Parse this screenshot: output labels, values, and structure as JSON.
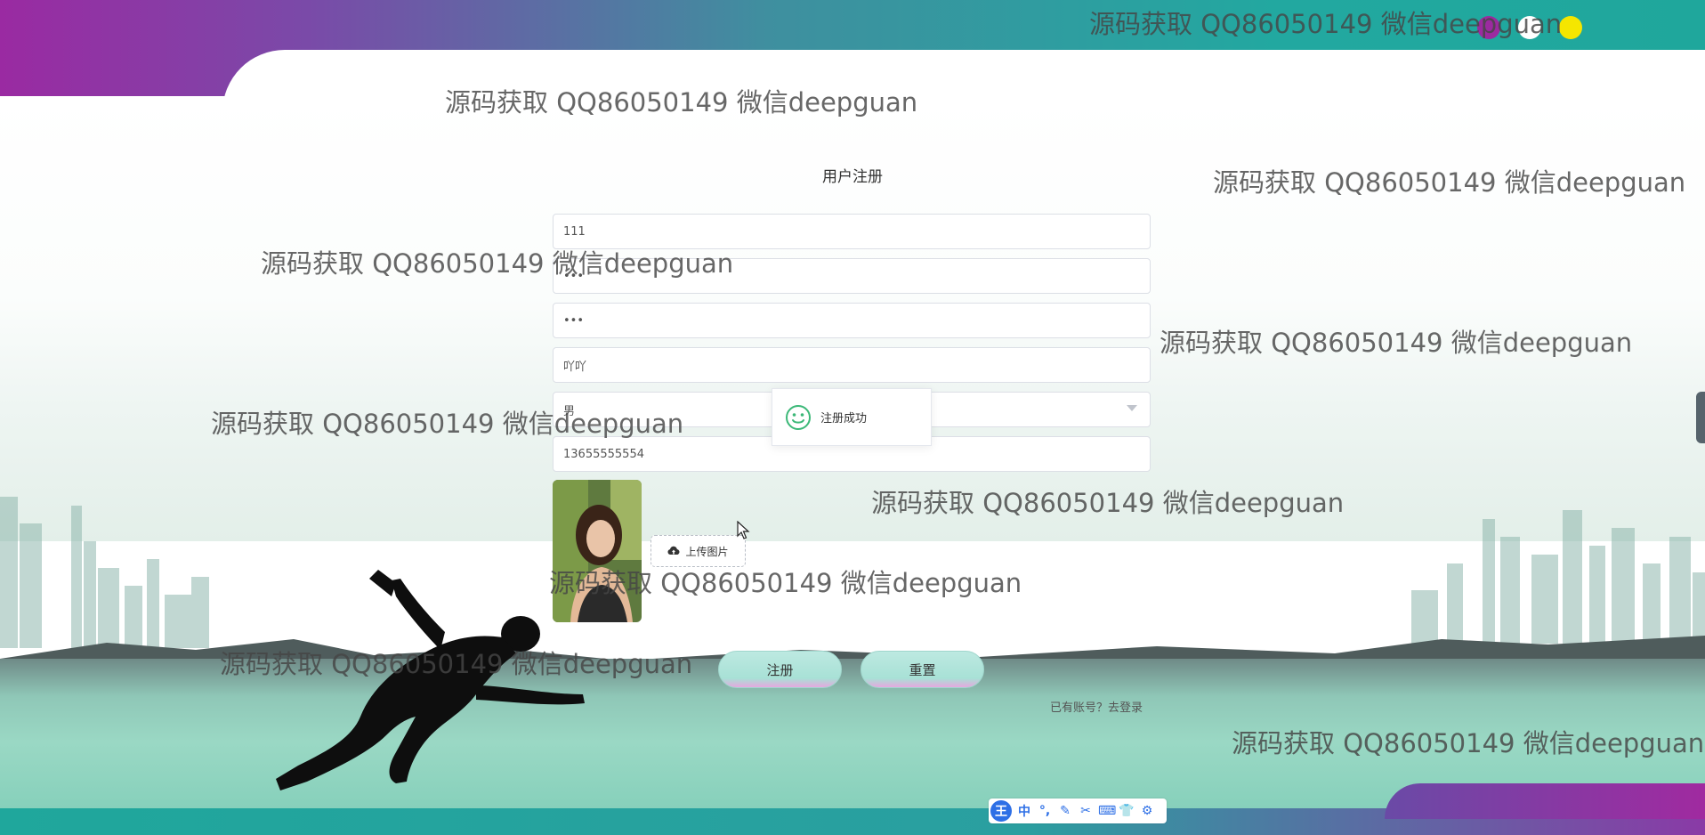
{
  "form": {
    "title": "用户注册",
    "account": "111",
    "password": "•••",
    "confirm_password": "•••",
    "name": "吖吖",
    "gender": "男",
    "phone": "13655555554",
    "upload_label": "上传图片"
  },
  "buttons": {
    "register": "注册",
    "reset": "重置"
  },
  "login_link": "已有账号？去登录",
  "toast": {
    "message": "注册成功"
  },
  "watermarks": [
    "源码获取 QQ86050149 微信deepguan",
    "源码获取 QQ86050149 微信deepguan",
    "源码获取 QQ86050149 微信deepguan",
    "源码获取 QQ86050149 微信deepguan",
    "源码获取 QQ86050149 微信deepguan",
    "源码获取 QQ86050149 微信deepguan",
    "源码获取 QQ86050149 微信deepguan",
    "源码获取 QQ86050149 微信deepguan",
    "源码获取 QQ86050149 微信deepguan",
    "源码获取 QQ86050149 微信deepguan"
  ],
  "ime_toolbar": {
    "logo": "王",
    "mode": "中",
    "items": [
      "°,",
      "✎",
      "✂",
      "⌨",
      "👕",
      "⚙"
    ]
  },
  "colors": {
    "accent_teal": "#1fa79c",
    "accent_purple": "#9a2aa2",
    "dot_purple": "#9c2aa0",
    "dot_white": "#ffffff",
    "dot_yellow": "#f5e600",
    "button_fill": "#a8e1d6"
  }
}
